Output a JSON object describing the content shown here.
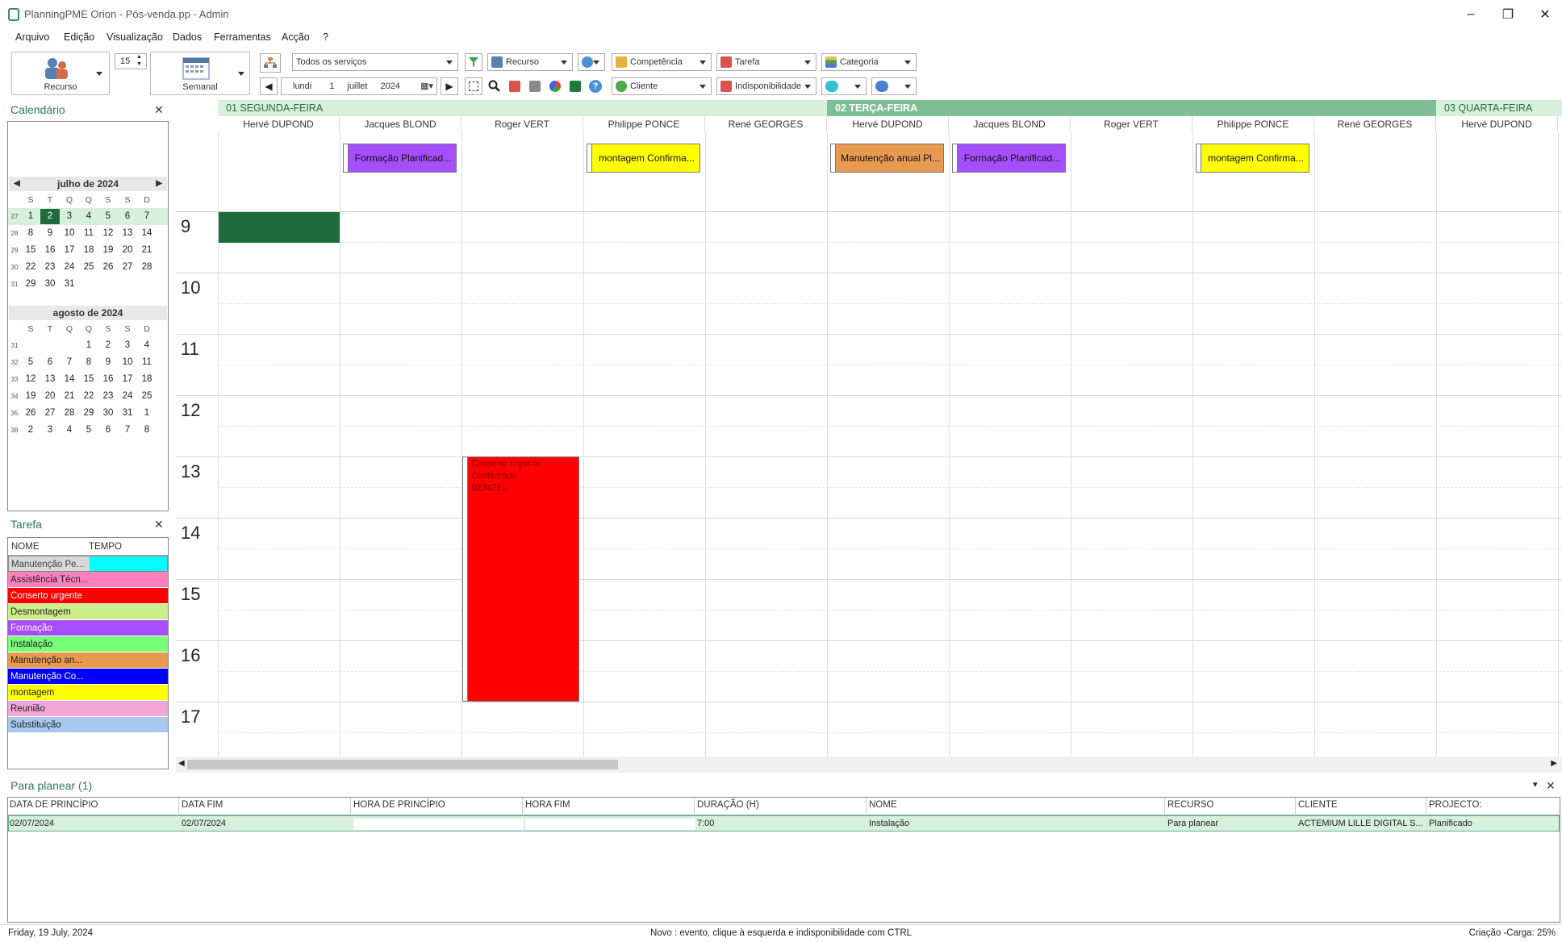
{
  "window": {
    "title": "PlanningPME Orion - Pós-venda.pp - Admin"
  },
  "menu": [
    "Arquivo",
    "Edição",
    "Visualização",
    "Dados",
    "Ferramentas",
    "Acção",
    "?"
  ],
  "toolbar": {
    "resource_label": "Recurso",
    "stepper_value": "15",
    "view_label": "Semanal",
    "services_filter": "Todos os serviços",
    "resource_filter": "Recurso",
    "competence_filter": "Competência",
    "task_filter": "Tarefa",
    "category_filter": "Categoria",
    "client_filter": "Cliente",
    "unavailability_filter": "Indisponibilidade",
    "date": {
      "weekday": "lundi",
      "day": "1",
      "month": "juillet",
      "year": "2024"
    }
  },
  "calendar": {
    "title": "Calendário",
    "weekday_headers": [
      "S",
      "T",
      "Q",
      "Q",
      "S",
      "S",
      "D"
    ],
    "months": [
      {
        "name": "julho de 2024",
        "weeks": [
          {
            "wk": "27",
            "days": [
              "1",
              "2",
              "3",
              "4",
              "5",
              "6",
              "7"
            ]
          },
          {
            "wk": "28",
            "days": [
              "8",
              "9",
              "10",
              "11",
              "12",
              "13",
              "14"
            ]
          },
          {
            "wk": "29",
            "days": [
              "15",
              "16",
              "17",
              "18",
              "19",
              "20",
              "21"
            ]
          },
          {
            "wk": "30",
            "days": [
              "22",
              "23",
              "24",
              "25",
              "26",
              "27",
              "28"
            ]
          },
          {
            "wk": "31",
            "days": [
              "29",
              "30",
              "31",
              "",
              "",
              "",
              ""
            ]
          }
        ]
      },
      {
        "name": "agosto de 2024",
        "weeks": [
          {
            "wk": "31",
            "days": [
              "",
              "",
              "",
              "1",
              "2",
              "3",
              "4"
            ]
          },
          {
            "wk": "32",
            "days": [
              "5",
              "6",
              "7",
              "8",
              "9",
              "10",
              "11"
            ]
          },
          {
            "wk": "33",
            "days": [
              "12",
              "13",
              "14",
              "15",
              "16",
              "17",
              "18"
            ]
          },
          {
            "wk": "34",
            "days": [
              "19",
              "20",
              "21",
              "22",
              "23",
              "24",
              "25"
            ]
          },
          {
            "wk": "35",
            "days": [
              "26",
              "27",
              "28",
              "29",
              "30",
              "31",
              "1"
            ]
          },
          {
            "wk": "36",
            "days": [
              "2",
              "3",
              "4",
              "5",
              "6",
              "7",
              "8"
            ]
          }
        ]
      }
    ],
    "selected_day": "2"
  },
  "tasks": {
    "title": "Tarefa",
    "col_name": "NOME",
    "col_time": "TEMPO",
    "items": [
      {
        "name": "Manutenção Pe...",
        "color": "#d9d9d9",
        "text": "#444",
        "time_color": "#00ffff"
      },
      {
        "name": "Assistência Técn...",
        "color": "#ff7fbf",
        "text": "#222"
      },
      {
        "name": "Conserto urgente",
        "color": "#ff0000",
        "text": "#fff"
      },
      {
        "name": "Desmontagem",
        "color": "#ccee88",
        "text": "#222"
      },
      {
        "name": "Formação",
        "color": "#a64dff",
        "text": "#fff"
      },
      {
        "name": "Instalação",
        "color": "#77ff77",
        "text": "#222"
      },
      {
        "name": "Manutenção an...",
        "color": "#e89a50",
        "text": "#222"
      },
      {
        "name": "Manutenção Co...",
        "color": "#0000ff",
        "text": "#fff"
      },
      {
        "name": "montagem",
        "color": "#ffff00",
        "text": "#222"
      },
      {
        "name": "Reunião",
        "color": "#f2a6d8",
        "text": "#222"
      },
      {
        "name": "Substituição",
        "color": "#a8c8f0",
        "text": "#222"
      }
    ]
  },
  "planner": {
    "days": [
      {
        "label": "01 SEGUNDA-FEIRA",
        "bold": false,
        "bg": "#d6f0dc",
        "color": "#2a6a40"
      },
      {
        "label": "02 TERÇA-FEIRA",
        "bold": true,
        "bg": "#7fbf95",
        "color": "#fff"
      },
      {
        "label": "03 QUARTA-FEIRA",
        "bold": false,
        "bg": "#d6f0dc",
        "color": "#2a6a40"
      }
    ],
    "resources": [
      "Hervé DUPOND",
      "Jacques BLOND",
      "Roger VERT",
      "Philippe PONCE",
      "René GEORGES",
      "Hervé DUPOND",
      "Jacques BLOND",
      "Roger VERT",
      "Philippe PONCE",
      "René GEORGES",
      "Hervé DUPOND"
    ],
    "hours": [
      "9",
      "10",
      "11",
      "12",
      "13",
      "14",
      "15",
      "16",
      "17"
    ],
    "allday_events": [
      {
        "col": 1,
        "label": "Formação Planificad...",
        "color": "#a64dff",
        "text": "#111"
      },
      {
        "col": 3,
        "label": "montagem Confirma...",
        "color": "#ffff00",
        "text": "#111"
      },
      {
        "col": 5,
        "label": "Manutenção anual Pl...",
        "color": "#e89a50",
        "text": "#111"
      },
      {
        "col": 6,
        "label": "Formação Planificad...",
        "color": "#a64dff",
        "text": "#111"
      },
      {
        "col": 8,
        "label": "montagem Confirma...",
        "color": "#ffff00",
        "text": "#111"
      }
    ],
    "big_event": {
      "line1": "Conserto urgente",
      "line2": "Confirmado",
      "line3": "DENGEL",
      "color": "#ff0000",
      "text": "#8b0000"
    }
  },
  "to_plan": {
    "title": "Para planear (1)",
    "columns": [
      "DATA DE PRINCÍPIO",
      "DATA FIM",
      "HORA DE PRINCÍPIO",
      "HORA FIM",
      "DURAÇÃO (H)",
      "NOME",
      "RECURSO",
      "CLIENTE",
      "PROJECTO:"
    ],
    "rows": [
      [
        "02/07/2024",
        "02/07/2024",
        "",
        "",
        "7:00",
        "Instalação",
        "Para planear",
        "ACTEMIUM LILLE DIGITAL S...",
        "Planificado"
      ]
    ]
  },
  "status": {
    "left": "Friday, 19 July, 2024",
    "center": "Novo : evento, clique à esquerda e indisponibilidade com CTRL",
    "right": "Criação -Carga: 25%"
  }
}
